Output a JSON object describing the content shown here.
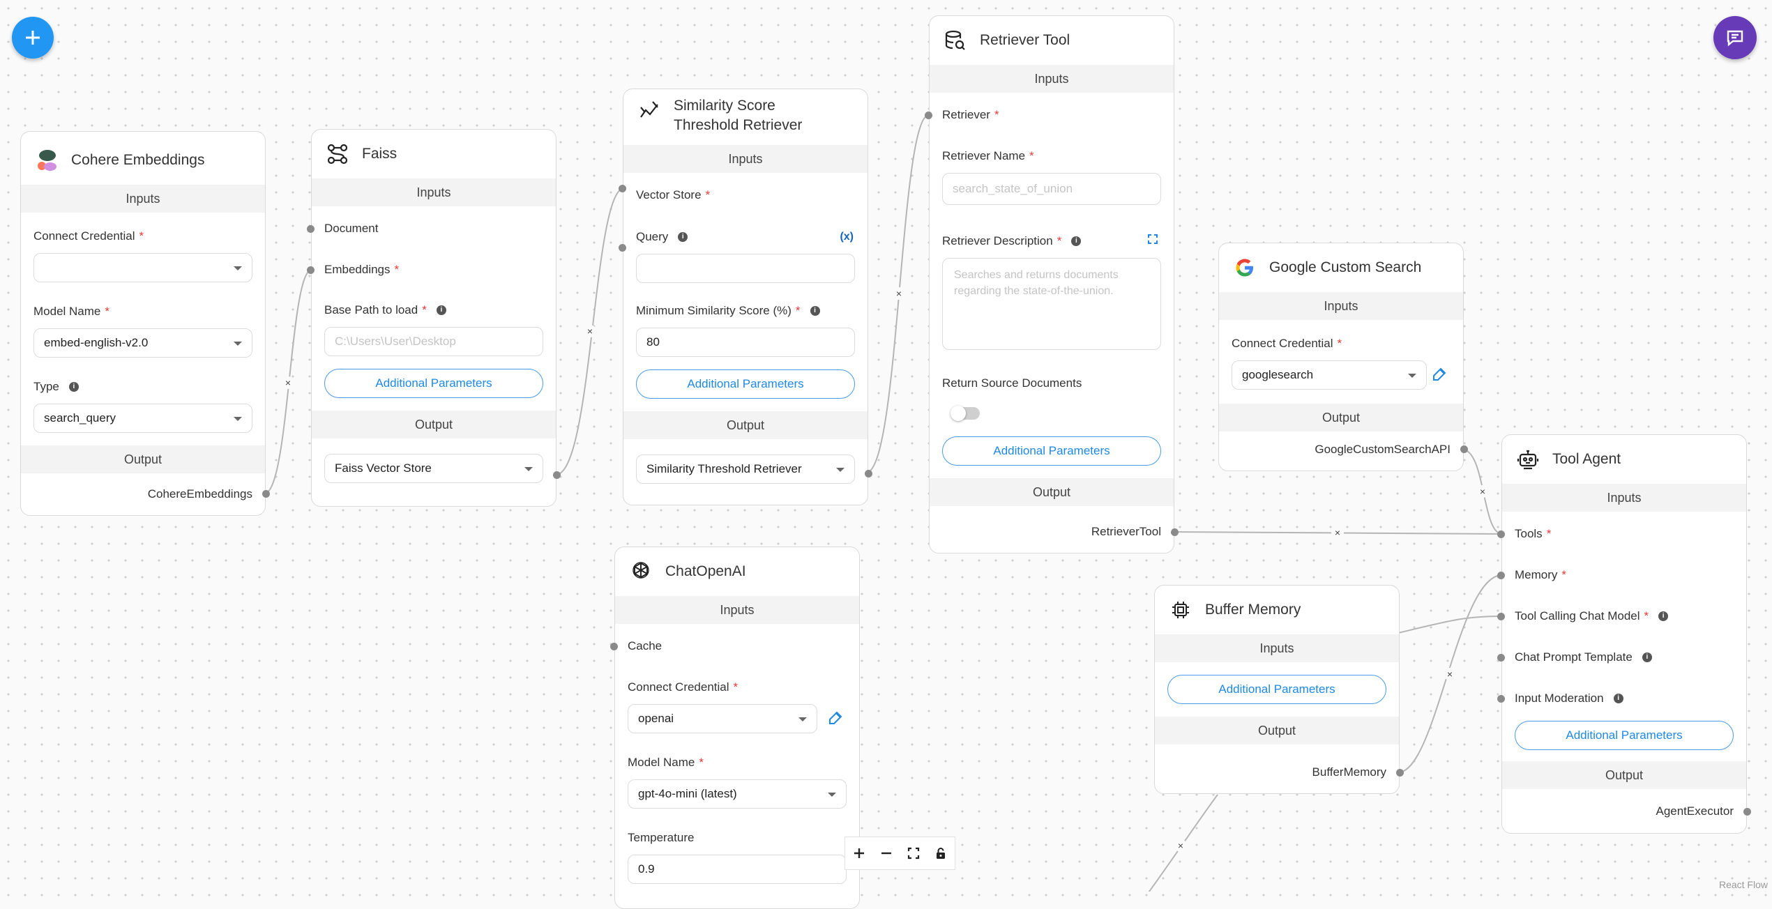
{
  "nodes": {
    "cohere": {
      "title": "Cohere Embeddings",
      "inputs_label": "Inputs",
      "credential_label": "Connect Credential",
      "credential_value": "",
      "model_label": "Model Name",
      "model_value": "embed-english-v2.0",
      "type_label": "Type",
      "type_value": "search_query",
      "output_label": "Output",
      "output_value": "CohereEmbeddings"
    },
    "faiss": {
      "title": "Faiss",
      "inputs_label": "Inputs",
      "document_label": "Document",
      "embeddings_label": "Embeddings",
      "basepath_label": "Base Path to load",
      "basepath_placeholder": "C:\\Users\\User\\Desktop",
      "additional_label": "Additional Parameters",
      "output_label": "Output",
      "output_value": "Faiss Vector Store"
    },
    "similarity": {
      "title": "Similarity Score Threshold Retriever",
      "inputs_label": "Inputs",
      "vector_store_label": "Vector Store",
      "query_label": "Query",
      "query_variable": "(x)",
      "min_score_label": "Minimum Similarity Score (%)",
      "min_score_value": "80",
      "additional_label": "Additional Parameters",
      "output_label": "Output",
      "output_value": "Similarity Threshold Retriever"
    },
    "retriever_tool": {
      "title": "Retriever Tool",
      "inputs_label": "Inputs",
      "retriever_label": "Retriever",
      "name_label": "Retriever Name",
      "name_placeholder": "search_state_of_union",
      "desc_label": "Retriever Description",
      "desc_placeholder": "Searches and returns documents regarding the state-of-the-union.",
      "return_source_label": "Return Source Documents",
      "return_source_value": false,
      "additional_label": "Additional Parameters",
      "output_label": "Output",
      "output_value": "RetrieverTool"
    },
    "google": {
      "title": "Google Custom Search",
      "inputs_label": "Inputs",
      "credential_label": "Connect Credential",
      "credential_value": "googlesearch",
      "output_label": "Output",
      "output_value": "GoogleCustomSearchAPI"
    },
    "tool_agent": {
      "title": "Tool Agent",
      "inputs_label": "Inputs",
      "tools_label": "Tools",
      "memory_label": "Memory",
      "chat_model_label": "Tool Calling Chat Model",
      "prompt_label": "Chat Prompt Template",
      "moderation_label": "Input Moderation",
      "additional_label": "Additional Parameters",
      "output_label": "Output",
      "output_value": "AgentExecutor"
    },
    "chatopenai": {
      "title": "ChatOpenAI",
      "inputs_label": "Inputs",
      "cache_label": "Cache",
      "credential_label": "Connect Credential",
      "credential_value": "openai",
      "model_label": "Model Name",
      "model_value": "gpt-4o-mini (latest)",
      "temperature_label": "Temperature",
      "temperature_value": "0.9"
    },
    "buffer": {
      "title": "Buffer Memory",
      "inputs_label": "Inputs",
      "additional_label": "Additional Parameters",
      "output_label": "Output",
      "output_value": "BufferMemory"
    }
  },
  "canvas": {
    "attribution": "React Flow",
    "edge_color": "#b5b5b5",
    "accent": "#1e88e5",
    "chat_button_color": "#673ab7"
  },
  "icons": {
    "add_node": "plus-icon",
    "chat": "chat-bubble-icon",
    "zoom_in": "plus-icon",
    "zoom_out": "minus-icon",
    "fit_view": "fullscreen-icon",
    "lock": "lock-icon"
  }
}
